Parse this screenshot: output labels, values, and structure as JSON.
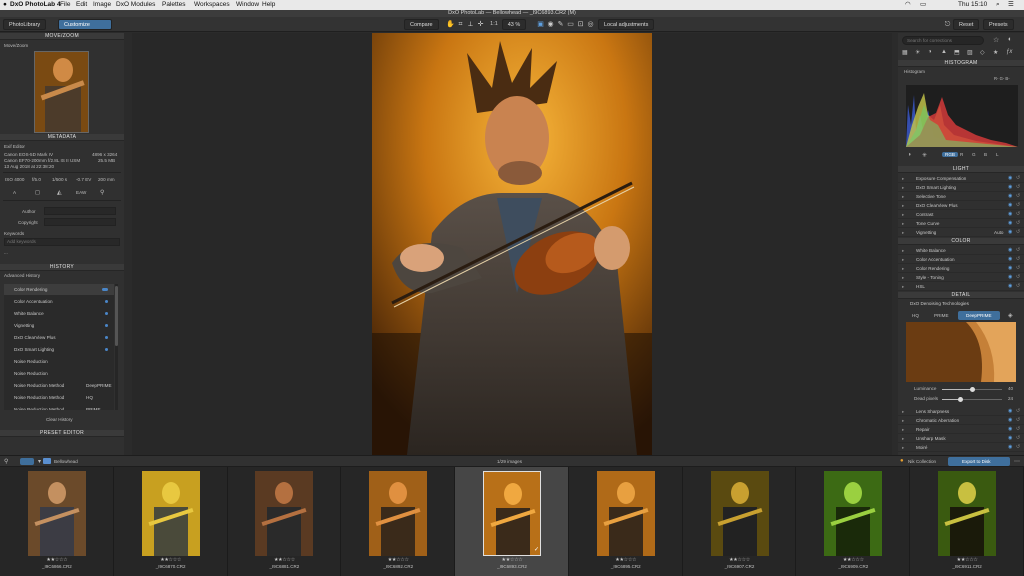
{
  "menubar": {
    "app": "DxO PhotoLab 4",
    "items": [
      "File",
      "Edit",
      "Image",
      "DxO Modules",
      "Palettes",
      "Workspaces",
      "Window",
      "Help"
    ],
    "clock": "Thu 15:10"
  },
  "window": {
    "title": "DxO PhotoLab — Bellowhead — _I9C6893.CR2 (M)"
  },
  "toolbar": {
    "tab_library": "PhotoLibrary",
    "tab_customize": "Customize",
    "compare": "Compare",
    "ratio": "1:1",
    "zoom": "43 %",
    "local_adjustments": "Local adjustments",
    "reset": "Reset",
    "presets": "Presets"
  },
  "left": {
    "movezoom": {
      "title": "MOVE/ZOOM",
      "sub": "Move/Zoom"
    },
    "metadata": {
      "title": "METADATA",
      "exif_editor": "Exif Editor",
      "camera": "Canon EOS-5D Mark IV",
      "lens": "Canon EF70-200mm f/2.8L IS II USM",
      "date": "13 Aug 2018 at 22:38:20",
      "dimensions": "4896 x 3264",
      "size": "25.5 MB",
      "iso": "ISO 4000",
      "aperture": "f/5.0",
      "shutter": "1/500 s",
      "ev": "-0.7 EV",
      "focal": "200 mm",
      "mode": "A",
      "wb": "EAW",
      "author": "Author",
      "copyright": "Copyright",
      "keywords": "Keywords",
      "add_keywords": "Add keywords",
      "ellipsis": "..."
    },
    "history": {
      "title": "HISTORY",
      "advanced": "Advanced History",
      "items": [
        {
          "label": "Color Rendering",
          "value": ""
        },
        {
          "label": "Color Accentuation",
          "value": ""
        },
        {
          "label": "White Balance",
          "value": ""
        },
        {
          "label": "Vignetting",
          "value": ""
        },
        {
          "label": "DxO ClearView Plus",
          "value": ""
        },
        {
          "label": "DxO Smart Lighting",
          "value": ""
        },
        {
          "label": "Noise Reduction",
          "value": ""
        },
        {
          "label": "Noise Reduction",
          "value": ""
        },
        {
          "label": "Noise Reduction Method",
          "value": "DeepPRIME"
        },
        {
          "label": "Noise Reduction Method",
          "value": "HQ"
        },
        {
          "label": "Noise Reduction Method",
          "value": "PRIME"
        }
      ],
      "clear": "Clear History"
    },
    "preset_editor": "PRESET EDITOR"
  },
  "right": {
    "search_placeholder": "Search for corrections",
    "histogram": {
      "title": "HISTOGRAM",
      "sub": "Histogram",
      "channels_label": "R- G- B-",
      "channel_buttons": [
        "RGB",
        "R",
        "G",
        "B",
        "L"
      ]
    },
    "light": {
      "title": "LIGHT",
      "items": [
        {
          "label": "Exposure Compensation",
          "value": ""
        },
        {
          "label": "DxO Smart Lighting",
          "value": ""
        },
        {
          "label": "Selective Tone",
          "value": ""
        },
        {
          "label": "DxO ClearView Plus",
          "value": ""
        },
        {
          "label": "Contrast",
          "value": ""
        },
        {
          "label": "Tone Curve",
          "value": ""
        },
        {
          "label": "Vignetting",
          "value": "Auto"
        }
      ]
    },
    "color": {
      "title": "COLOR",
      "items": [
        {
          "label": "White Balance"
        },
        {
          "label": "Color Accentuation"
        },
        {
          "label": "Color Rendering"
        },
        {
          "label": "Style - Toning"
        },
        {
          "label": "HSL"
        }
      ]
    },
    "detail": {
      "title": "DETAIL",
      "denoise": "DxO Denoising Technologies",
      "methods": [
        "HQ",
        "PRIME",
        "DeepPRIME"
      ],
      "luminance_label": "Luminance",
      "luminance_value": "40",
      "luminance_frac": 0.5,
      "deadpixels_label": "Dead pixels",
      "deadpixels_value": "24",
      "deadpixels_frac": 0.3,
      "items": [
        "Lens Sharpness",
        "Chromatic Aberration",
        "Repair",
        "Unsharp Mask",
        "Moiré"
      ]
    }
  },
  "filmbar": {
    "folder": "Bellowhead",
    "count": "1/29 images",
    "nik": "Nik Collection",
    "export": "Export to Disk"
  },
  "filmstrip": [
    {
      "name": "_I9C6866.CR2",
      "stars": "★★☆☆☆",
      "selected": false
    },
    {
      "name": "_I9C6870.CR2",
      "stars": "★★☆☆☆",
      "selected": false
    },
    {
      "name": "_I9C6881.CR2",
      "stars": "★★☆☆☆",
      "selected": false
    },
    {
      "name": "_I9C6892.CR2",
      "stars": "★★☆☆☆",
      "selected": false
    },
    {
      "name": "_I9C6893.CR2",
      "stars": "★★☆☆☆",
      "selected": true
    },
    {
      "name": "_I9C6895.CR2",
      "stars": "★★☆☆☆",
      "selected": false
    },
    {
      "name": "_I9C6907.CR2",
      "stars": "★★☆☆☆",
      "selected": false
    },
    {
      "name": "_I9C6909.CR2",
      "stars": "★★☆☆☆",
      "selected": false
    },
    {
      "name": "_I9C6911.CR2",
      "stars": "★★☆☆☆",
      "selected": false
    }
  ]
}
